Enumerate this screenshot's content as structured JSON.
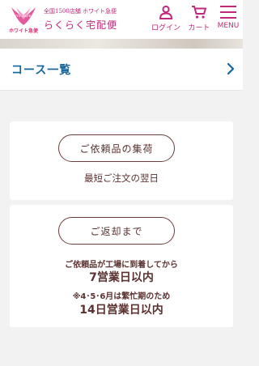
{
  "header": {
    "logo_text": "ホワイト急便",
    "brand_sub": "全国1500店舗 ホワイト急便",
    "brand_main": "らくらく宅配便",
    "nav": [
      {
        "label": "ログイン",
        "icon": "user-icon"
      },
      {
        "label": "カート",
        "icon": "cart-icon"
      },
      {
        "label": "MENU",
        "icon": "hamburger-menu-icon"
      }
    ]
  },
  "course": {
    "title": "コース一覧",
    "icon": "chevron-right-icon"
  },
  "pickup_card": {
    "button_label": "ご依頼品の集荷",
    "description": "最短ご注文の翌日"
  },
  "return_card": {
    "button_label": "ご返却まで",
    "line1": "ご依頼品が工場に到着してから",
    "line2": "7営業日以内",
    "line3": "※4･5･6月は繁忙期のため",
    "line4": "14日営業日以内"
  },
  "colors": {
    "brand_pink": "#c2277a",
    "course_blue": "#15649a",
    "text_brown": "#5a3230",
    "background": "#f2f2f2"
  }
}
